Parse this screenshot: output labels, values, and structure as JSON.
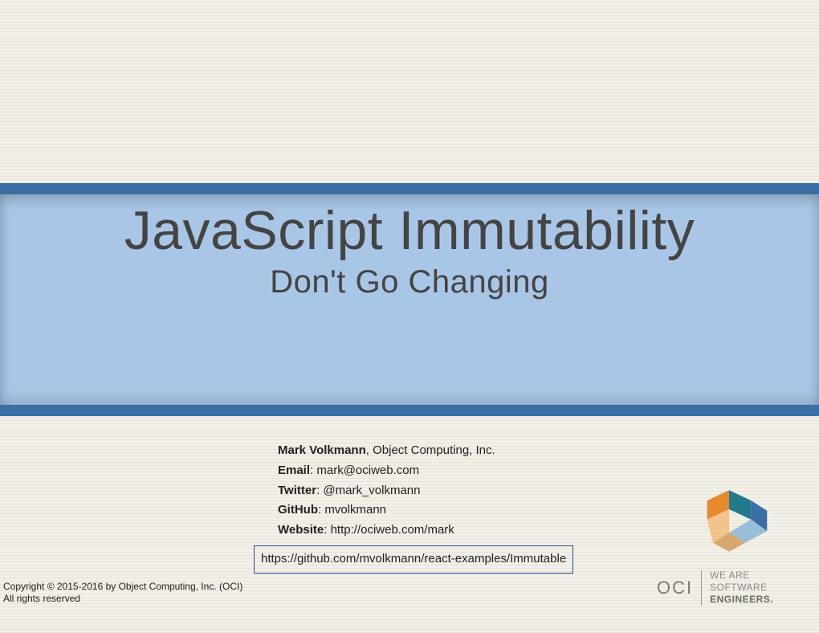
{
  "title": "JavaScript Immutability",
  "subtitle": "Don't Go Changing",
  "author": {
    "name": "Mark Volkmann",
    "org_suffix": ", Object Computing, Inc.",
    "email_label": "Email",
    "email_value": ": mark@ociweb.com",
    "twitter_label": "Twitter",
    "twitter_value": ": @mark_volkmann",
    "github_label": "GitHub",
    "github_value": ": mvolkmann",
    "website_label": "Website",
    "website_value": ": http://ociweb.com/mark"
  },
  "repo_link": "https://github.com/mvolkmann/react-examples/Immutable",
  "copyright_line1": "Copyright © 2015-2016 by Object Computing, Inc. (OCI)",
  "copyright_line2": "All rights reserved",
  "logo": {
    "oci": "OCI",
    "tag1": "WE ARE",
    "tag2": "SOFTWARE",
    "tag3": "ENGINEERS."
  }
}
